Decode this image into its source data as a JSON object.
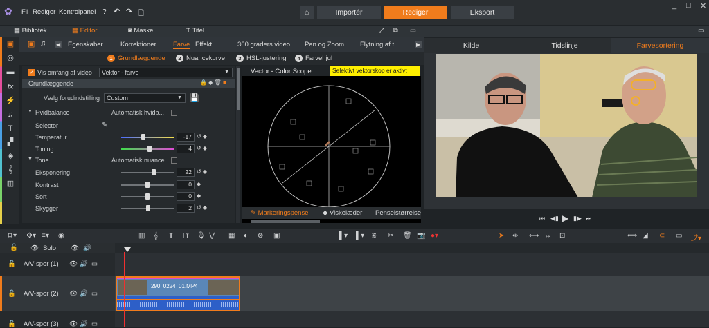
{
  "app": {
    "menus": [
      "Fil",
      "Rediger",
      "Kontrolpanel"
    ],
    "modes": [
      "Importér",
      "Rediger",
      "Eksport"
    ],
    "active_mode": "Rediger",
    "accent": "#f07c1c"
  },
  "editor_tabs": [
    "Bibliotek",
    "Editor",
    "Maske",
    "Titel"
  ],
  "inspector_tabs": [
    "Egenskaber",
    "Korrektioner",
    "Farve",
    "Effekt",
    "360 graders video",
    "Pan og Zoom",
    "Flytning af t"
  ],
  "subtabs": [
    {
      "num": "1",
      "label": "Grundlæggende"
    },
    {
      "num": "2",
      "label": "Nuancekurve"
    },
    {
      "num": "3",
      "label": "HSL-justering"
    },
    {
      "num": "4",
      "label": "Farvehjul"
    }
  ],
  "scope": {
    "show_scope_label": "Vis omfang af video",
    "scope_select": "Vektor - farve",
    "title": "Vector - Color Scope",
    "badge": "Selektivt vektorskop er aktivt",
    "footer": [
      "Markeringspensel",
      "Viskelæder",
      "Penselstørrelse"
    ]
  },
  "basic": {
    "section": "Grundlæggende",
    "preset_label": "Vælg forudindstilling",
    "preset_value": "Custom",
    "wb_label": "Hvidbalance",
    "auto_wb": "Automatisk hvidb...",
    "selector": "Selector",
    "temperature": {
      "label": "Temperatur",
      "value": "-17"
    },
    "tint": {
      "label": "Toning",
      "value": "4"
    },
    "tone_label": "Tone",
    "auto_tone": "Automatisk nuance",
    "exposure": {
      "label": "Eksponering",
      "value": "22"
    },
    "contrast": {
      "label": "Kontrast",
      "value": "0"
    },
    "black": {
      "label": "Sort",
      "value": "0"
    },
    "shadows": {
      "label": "Skygger",
      "value": "2"
    }
  },
  "preview_tabs": [
    "Kilde",
    "Tidslinje",
    "Farvesortering"
  ],
  "timeline": {
    "solo": "Solo",
    "tracks": [
      "A/V-spor (1)",
      "A/V-spor (2)",
      "A/V-spor (3)"
    ],
    "clip_name": "290_0224_01.MP4"
  }
}
